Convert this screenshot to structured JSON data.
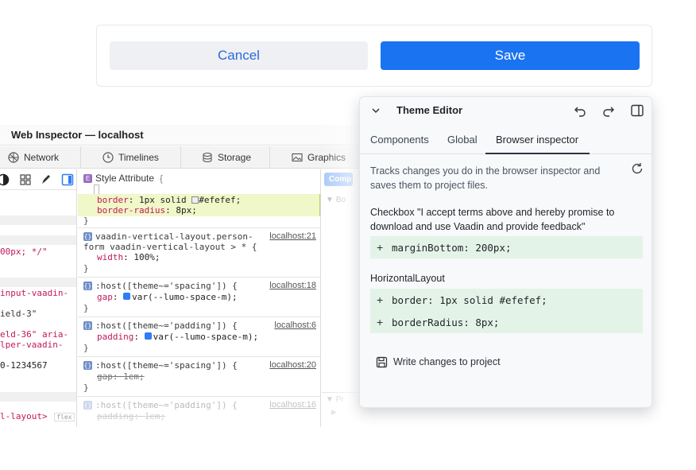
{
  "form": {
    "cancel_label": "Cancel",
    "save_label": "Save"
  },
  "inspector": {
    "title": "Web Inspector — localhost",
    "tabs": [
      {
        "label": "Network",
        "icon": "network-icon"
      },
      {
        "label": "Timelines",
        "icon": "clock-icon"
      },
      {
        "label": "Storage",
        "icon": "database-icon"
      },
      {
        "label": "Graphics",
        "icon": "image-icon"
      }
    ],
    "left_lines": [
      {
        "text": "00px; */\"",
        "color": "#c2185b"
      },
      {
        "text": "input-vaadin-",
        "color": "#c2185b"
      },
      {
        "text": "ield-3\"",
        "color": "#333333"
      },
      {
        "text": "eld-36\" aria-",
        "color": "#c2185b"
      },
      {
        "text": "lper-vaadin-",
        "color": "#c2185b"
      },
      {
        "text": "0-1234567",
        "color": "#222222"
      },
      {
        "text": "l-layout>",
        "color": "#c2185b"
      },
      {
        "text": "flex",
        "color": "#999999"
      }
    ],
    "style_attribute": {
      "label": "Style Attribute",
      "open": "{",
      "decls": [
        {
          "prop": "border",
          "value": "1px solid",
          "swatch": "#efefef",
          "value2": "#efefef;"
        },
        {
          "prop": "border-radius",
          "value": "8px;"
        }
      ],
      "close": "}"
    },
    "rules": [
      {
        "selector": "vaadin-vertical-layout.person-",
        "selector2": "form vaadin-vertical-layout > * {",
        "source": "localhost:21",
        "decls": [
          {
            "prop": "width",
            "value": "100%;",
            "strike": false
          }
        ]
      },
      {
        "selector": ":host([theme~='spacing']) {",
        "source": "localhost:18",
        "decls": [
          {
            "prop": "gap",
            "value": "var(--lumo-space-m);",
            "strike": false,
            "var": true
          }
        ]
      },
      {
        "selector": ":host([theme~='padding']) {",
        "source": "localhost:6",
        "decls": [
          {
            "prop": "padding",
            "value": "var(--lumo-space-m);",
            "strike": false,
            "var": true
          }
        ]
      },
      {
        "selector": ":host([theme~='spacing']) {",
        "source": "localhost:20",
        "decls": [
          {
            "prop": "gap",
            "value": "1em;",
            "strike": true
          }
        ]
      },
      {
        "selector": ":host([theme~='padding']) {",
        "source": "localhost:16",
        "decls": [
          {
            "prop": "padding",
            "value": "1em;",
            "strike": true
          }
        ]
      }
    ],
    "right_labels": [
      "Comp",
      "Bo",
      "Pr"
    ]
  },
  "theme_editor": {
    "title": "Theme Editor",
    "tabs": [
      "Components",
      "Global",
      "Browser inspector"
    ],
    "active_tab": "Browser inspector",
    "description": "Tracks changes you do in the browser inspector and saves them to project files.",
    "sections": [
      {
        "heading": "Checkbox \"I accept terms above and hereby promise to download and use Vaadin and provide feedback\"",
        "changes": [
          "marginBottom: 200px;"
        ]
      },
      {
        "heading": "HorizontalLayout",
        "changes": [
          "border: 1px solid #efefef;",
          "borderRadius: 8px;"
        ]
      }
    ],
    "write_label": "Write changes to project"
  },
  "colors": {
    "save_button": "#1a73f0",
    "cancel_text": "#2c6ad8",
    "change_bg": "#e4f3e8",
    "style_attr_bg": "#f0f7c8"
  }
}
